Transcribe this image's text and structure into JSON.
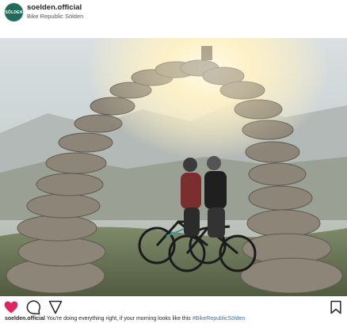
{
  "post": {
    "username": "soelden.official",
    "location": "Bike Republic Sölden",
    "avatar_text": "SÖLDEN"
  },
  "caption": {
    "username": "soelden.official",
    "text": "You're doing everything right, if your morning looks like this",
    "hashtag": "#BikeRepublicSölden"
  },
  "icons": [
    "heart-icon",
    "comment-icon",
    "share-icon",
    "bookmark-icon"
  ],
  "colors": {
    "avatar": "#1f6b5c",
    "heart": "#e0245e",
    "hashtag": "#3d6fa8"
  }
}
